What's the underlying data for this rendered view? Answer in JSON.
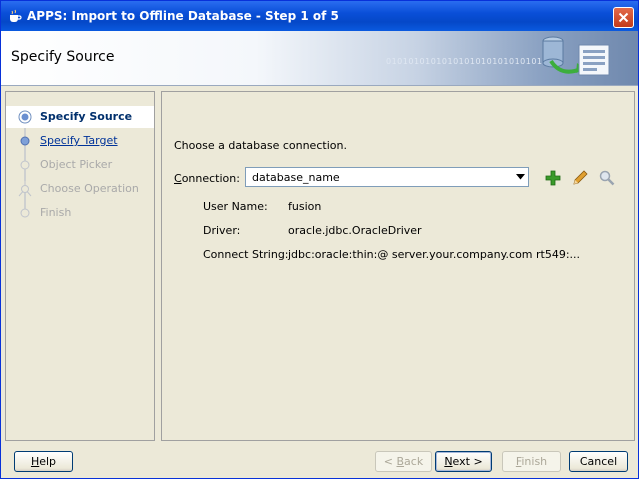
{
  "window": {
    "title": "APPS: Import to Offline Database - Step 1 of 5"
  },
  "banner": {
    "title": "Specify Source",
    "binary_text": "0101010101010101010101010101"
  },
  "nav": {
    "items": [
      {
        "label": "Specify Source",
        "state": "current"
      },
      {
        "label": "Specify Target",
        "state": "link"
      },
      {
        "label": "Object Picker",
        "state": "disabled"
      },
      {
        "label": "Choose Operation",
        "state": "disabled"
      },
      {
        "label": "Finish",
        "state": "disabled"
      }
    ]
  },
  "content": {
    "prompt": "Choose a database connection.",
    "connection_label_mnemonic": "C",
    "connection_label_rest": "onnection:",
    "connection_value": "database_name",
    "info": [
      {
        "label": "User Name:",
        "value": "fusion"
      },
      {
        "label": "Driver:",
        "value": "oracle.jdbc.OracleDriver"
      },
      {
        "label": "Connect String:",
        "value": "jdbc:oracle:thin:@ server.your.company.com rt549:..."
      }
    ]
  },
  "buttons": {
    "help_mnemonic": "H",
    "help_rest": "elp",
    "back_prefix": "< ",
    "back_mnemonic": "B",
    "back_rest": "ack",
    "next_mnemonic": "N",
    "next_rest": "ext >",
    "finish_mnemonic": "F",
    "finish_rest": "inish",
    "cancel": "Cancel"
  },
  "colors": {
    "titlebar": "#0a4fd8",
    "current_step": "#002f6c",
    "link": "#003399",
    "disabled": "#a9a9a9",
    "add_icon": "#3a9a2a"
  }
}
